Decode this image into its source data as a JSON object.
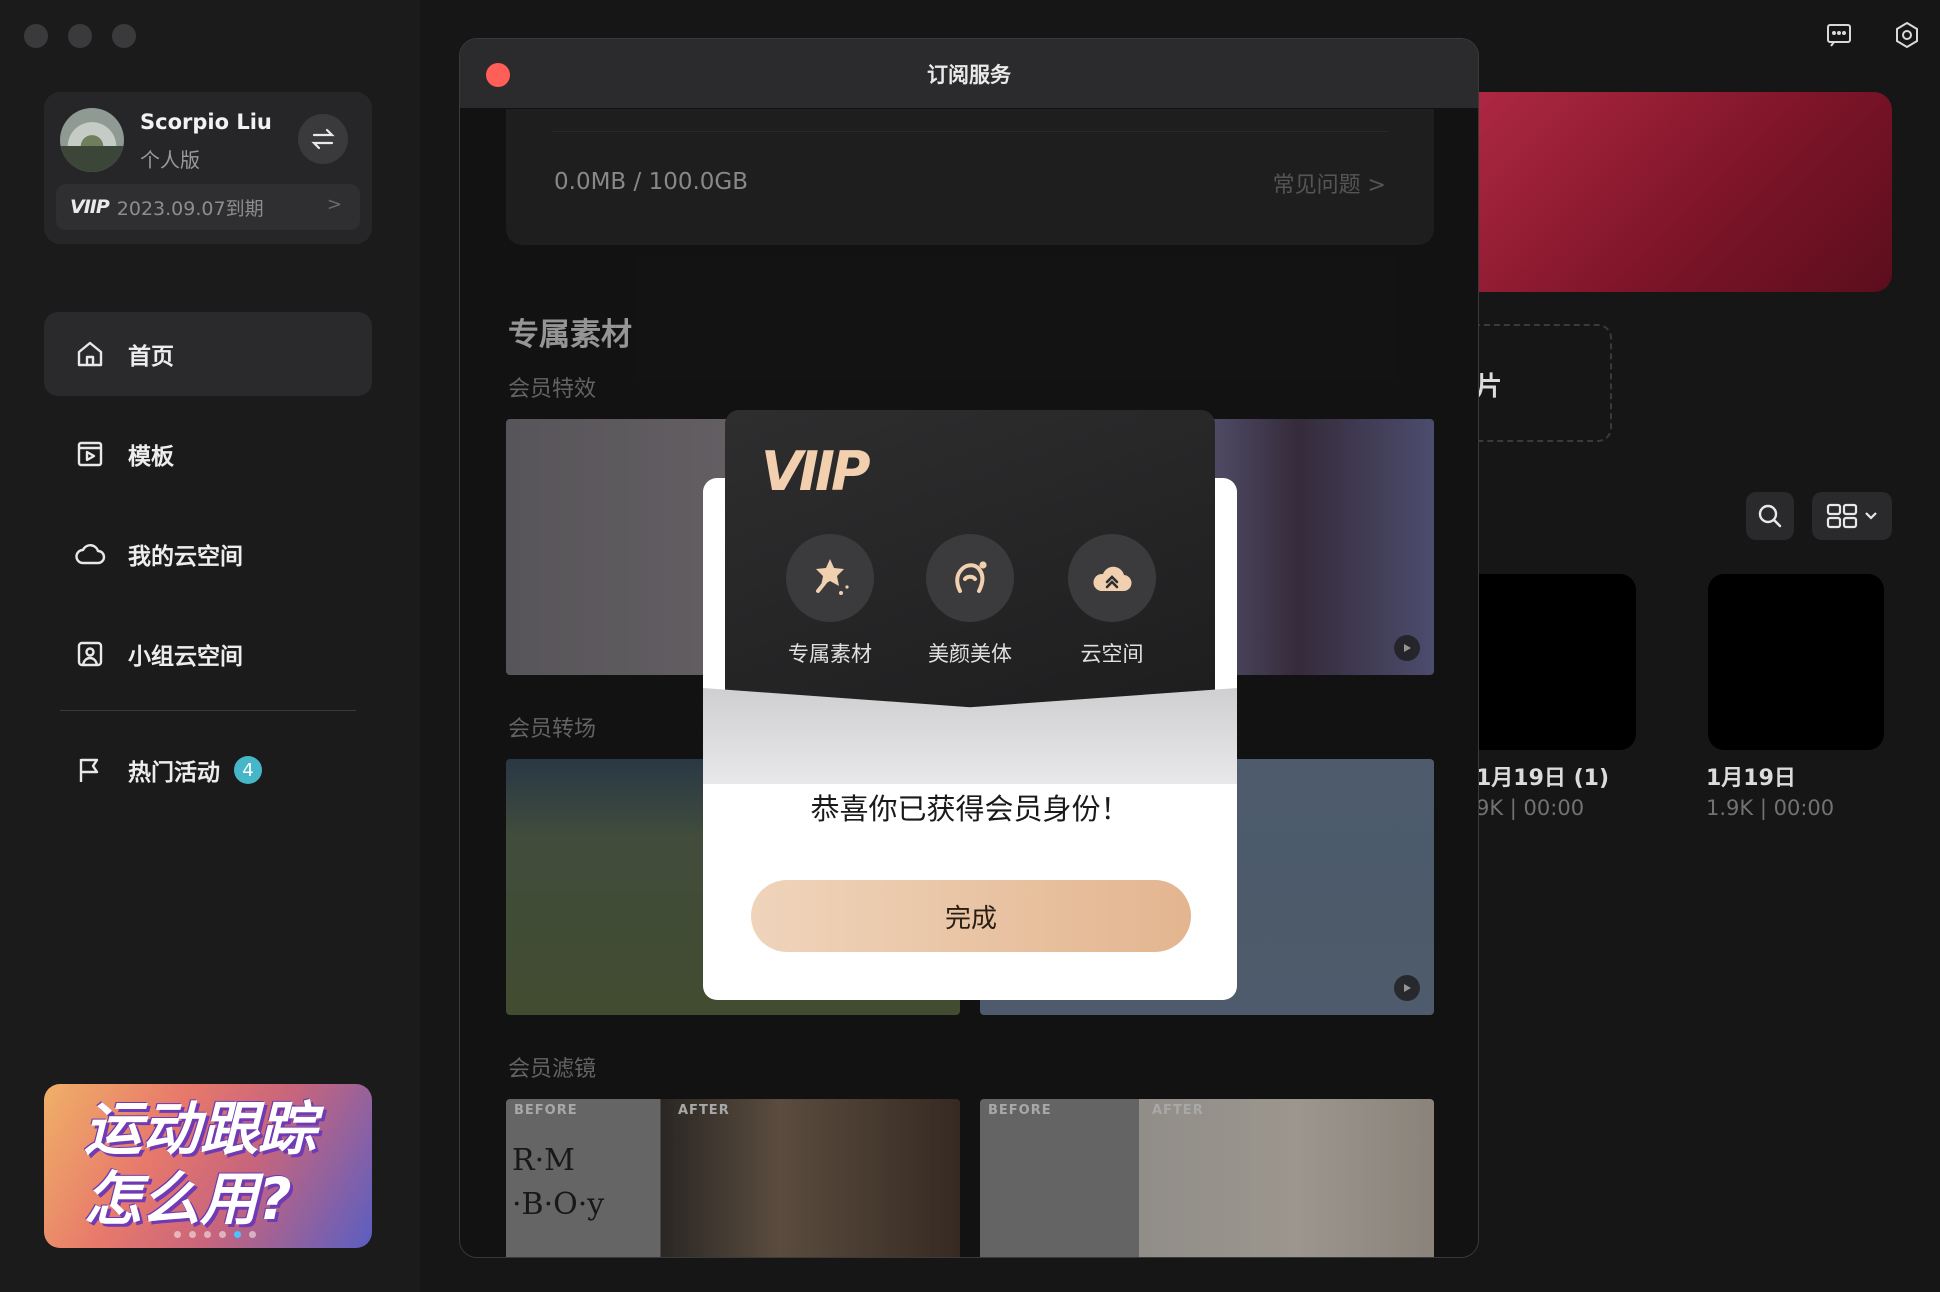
{
  "sidebar": {
    "user": {
      "name": "Scorpio Liu",
      "plan": "个人版"
    },
    "vip": {
      "logo": "VIIP",
      "expire": "2023.09.07到期",
      "arrow": ">"
    },
    "nav": [
      {
        "label": "首页",
        "icon": "home-icon"
      },
      {
        "label": "模板",
        "icon": "template-icon"
      },
      {
        "label": "我的云空间",
        "icon": "cloud-icon"
      },
      {
        "label": "小组云空间",
        "icon": "team-cloud-icon"
      }
    ],
    "activity": {
      "label": "热门活动",
      "badge": "4"
    },
    "promo": {
      "text": "运动跟踪\n怎么用?"
    }
  },
  "main": {
    "dashed_label": "片",
    "projects": [
      {
        "title": "1月19日 (1)",
        "meta": "9K | 00:00"
      },
      {
        "title": "1月19日",
        "meta": "1.9K | 00:00"
      }
    ]
  },
  "subscription": {
    "title": "订阅服务",
    "storage": {
      "used": "0.0MB",
      "sep": "/",
      "total": "100.0GB",
      "faq": "常见问题 >"
    },
    "section_title": "专属素材",
    "groups": [
      "会员特效",
      "会员转场",
      "会员滤镜"
    ],
    "before_label": "BEFORE",
    "after_label": "AFTER",
    "sign_text": "R·M\n·B·O·y"
  },
  "dialog": {
    "logo": "VIIP",
    "features": [
      {
        "label": "专属素材",
        "icon": "magic-star-icon"
      },
      {
        "label": "美颜美体",
        "icon": "beauty-icon"
      },
      {
        "label": "云空间",
        "icon": "cloud-upload-icon"
      }
    ],
    "message": "恭喜你已获得会员身份！",
    "button": "完成"
  }
}
